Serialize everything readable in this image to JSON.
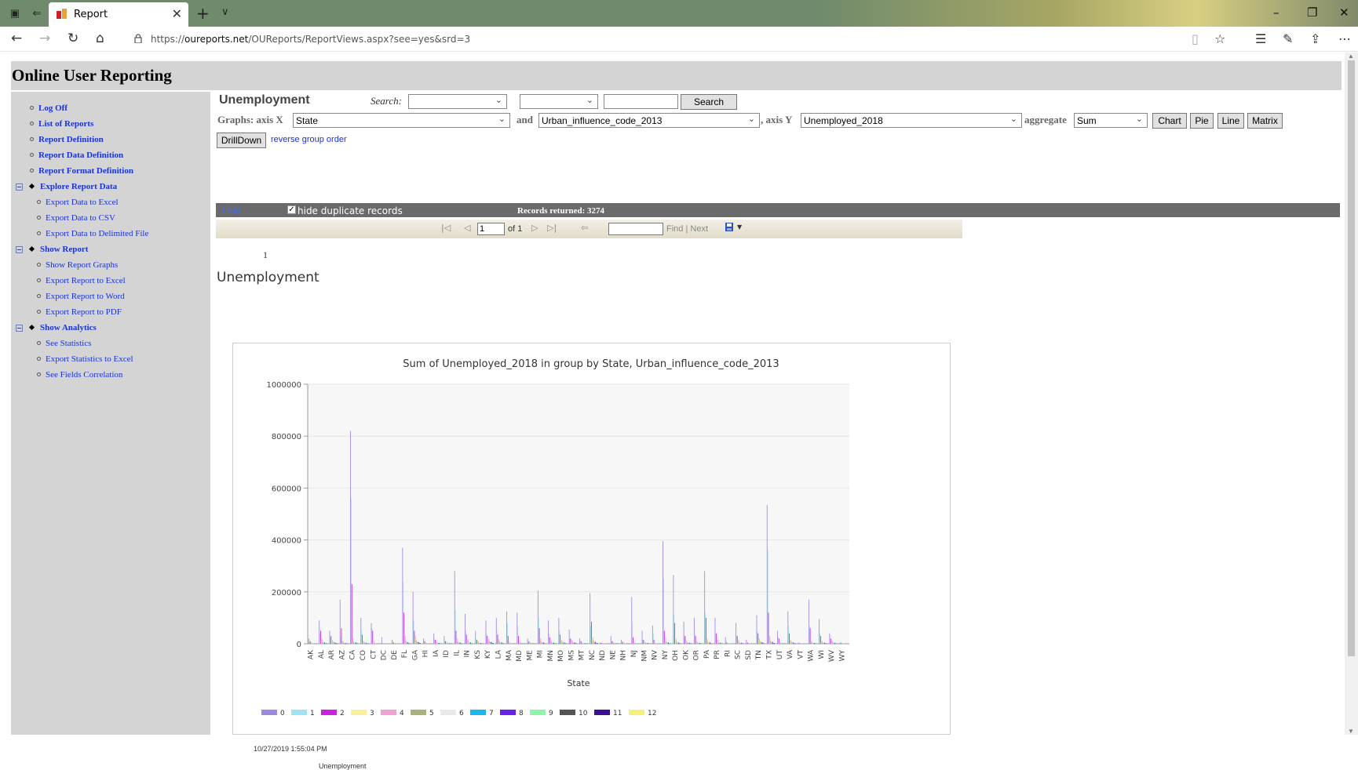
{
  "browser": {
    "tab_title": "Report",
    "url_prefix": "https://",
    "url_domain": "oureports.net",
    "url_path": "/OUReports/ReportViews.aspx?see=yes&srd=3"
  },
  "app": {
    "title": "Online User Reporting"
  },
  "sidebar": {
    "items": [
      {
        "label": "Log Off"
      },
      {
        "label": "List of Reports"
      },
      {
        "label": "Report Definition"
      },
      {
        "label": "Report Data Definition"
      },
      {
        "label": "Report Format Definition"
      }
    ],
    "groups": [
      {
        "label": "Explore Report Data",
        "toggle": "−",
        "children": [
          "Export Data to Excel",
          "Export Data to CSV",
          "Export Data to Delimited File"
        ]
      },
      {
        "label": "Show Report",
        "toggle": "−",
        "children": [
          "Show Report Graphs",
          "Export Report to Excel",
          "Export Report to Word",
          "Export Report to PDF"
        ]
      },
      {
        "label": "Show Analytics",
        "toggle": "−",
        "children": [
          "See Statistics",
          "Export Statistics to Excel",
          "See Fields Correlation"
        ]
      }
    ]
  },
  "report": {
    "title": "Unemployment",
    "search_label": "Search:",
    "search_button": "Search",
    "graphs_label": "Graphs: axis X",
    "axis_x": "State",
    "and_label": "and",
    "group_field": "Urban_influence_code_2013",
    "axis_y_label": ", axis Y",
    "axis_y": "Unemployed_2018",
    "aggregate_label": "aggregate",
    "aggregate": "Sum",
    "buttons": {
      "chart": "Chart",
      "pie": "Pie",
      "line": "Line",
      "matrix": "Matrix",
      "drilldown": "DrillDown"
    },
    "reverse_link": "reverse group order",
    "help": "Help",
    "hide_dup": "hide duplicate records",
    "records": "Records returned: 3274",
    "pager": {
      "page": "1",
      "of": "of 1",
      "find": "Find",
      "sep": "|",
      "next": "Next"
    },
    "page_number": "1",
    "heading": "Unemployment",
    "footer_date": "10/27/2019 1:55:04 PM",
    "footer_name": "Unemployment"
  },
  "chart_data": {
    "type": "bar",
    "title": "Sum of Unemployed_2018 in group by State, Urban_influence_code_2013",
    "xlabel": "State",
    "ylabel": "",
    "ylim": [
      0,
      1000000
    ],
    "yticks": [
      "0",
      "200000",
      "400000",
      "600000",
      "800000",
      "1000000"
    ],
    "categories": [
      "AK",
      "AL",
      "AR",
      "AZ",
      "CA",
      "CO",
      "CT",
      "DC",
      "DE",
      "FL",
      "GA",
      "HI",
      "IA",
      "ID",
      "IL",
      "IN",
      "KS",
      "KY",
      "LA",
      "MA",
      "MD",
      "ME",
      "MI",
      "MN",
      "MO",
      "MS",
      "MT",
      "NC",
      "ND",
      "NE",
      "NH",
      "NJ",
      "NM",
      "NV",
      "NY",
      "OH",
      "OK",
      "OR",
      "PA",
      "PR",
      "RI",
      "SC",
      "SD",
      "TN",
      "TX",
      "UT",
      "VA",
      "VT",
      "WA",
      "WI",
      "WV",
      "WY"
    ],
    "legend_position": "bottom",
    "series": [
      {
        "name": "0",
        "color": "#9b8ae0",
        "values": [
          20000,
          90000,
          50000,
          170000,
          820000,
          100000,
          80000,
          25000,
          15000,
          370000,
          200000,
          20000,
          40000,
          30000,
          280000,
          115000,
          50000,
          90000,
          100000,
          125000,
          120000,
          20000,
          205000,
          90000,
          100000,
          55000,
          20000,
          195000,
          5000,
          30000,
          15000,
          180000,
          50000,
          70000,
          395000,
          265000,
          85000,
          100000,
          280000,
          100000,
          25000,
          80000,
          15000,
          110000,
          535000,
          50000,
          125000,
          5000,
          170000,
          95000,
          40000,
          5000
        ]
      },
      {
        "name": "1",
        "color": "#9ee3f5",
        "values": [
          5000,
          40000,
          25000,
          25000,
          560000,
          50000,
          60000,
          0,
          8000,
          240000,
          90000,
          8000,
          20000,
          10000,
          130000,
          50000,
          20000,
          40000,
          50000,
          80000,
          70000,
          5000,
          100000,
          40000,
          50000,
          20000,
          8000,
          70000,
          2000,
          10000,
          5000,
          80000,
          15000,
          40000,
          250000,
          110000,
          30000,
          40000,
          120000,
          40000,
          10000,
          30000,
          5000,
          45000,
          360000,
          25000,
          70000,
          2000,
          70000,
          40000,
          20000,
          2000
        ]
      },
      {
        "name": "2",
        "color": "#cc22dd",
        "values": [
          10000,
          50000,
          30000,
          60000,
          230000,
          35000,
          50000,
          0,
          5000,
          120000,
          50000,
          10000,
          15000,
          10000,
          50000,
          35000,
          15000,
          30000,
          35000,
          30000,
          30000,
          10000,
          60000,
          25000,
          35000,
          20000,
          10000,
          85000,
          3000,
          10000,
          8000,
          25000,
          15000,
          15000,
          50000,
          80000,
          30000,
          30000,
          100000,
          40000,
          5000,
          30000,
          5000,
          40000,
          120000,
          20000,
          40000,
          3000,
          60000,
          30000,
          20000,
          4000
        ]
      },
      {
        "name": "3",
        "color": "#f7ef9a",
        "values": [
          3000,
          15000,
          12000,
          10000,
          15000,
          10000,
          5000,
          0,
          2000,
          20000,
          20000,
          3000,
          8000,
          6000,
          15000,
          12000,
          8000,
          15000,
          12000,
          5000,
          6000,
          5000,
          15000,
          10000,
          12000,
          10000,
          4000,
          20000,
          2000,
          5000,
          3000,
          5000,
          6000,
          3000,
          15000,
          15000,
          10000,
          8000,
          15000,
          10000,
          2000,
          10000,
          3000,
          15000,
          20000,
          5000,
          10000,
          2000,
          8000,
          10000,
          8000,
          2000
        ]
      },
      {
        "name": "4",
        "color": "#f2a0d0",
        "values": [
          6000,
          20000,
          15000,
          12000,
          20000,
          12000,
          10000,
          0,
          3000,
          30000,
          30000,
          5000,
          10000,
          7000,
          20000,
          18000,
          10000,
          20000,
          18000,
          8000,
          10000,
          6000,
          20000,
          12000,
          15000,
          15000,
          5000,
          25000,
          2000,
          6000,
          4000,
          8000,
          8000,
          4000,
          25000,
          20000,
          12000,
          10000,
          20000,
          15000,
          3000,
          15000,
          3000,
          20000,
          30000,
          6000,
          15000,
          2000,
          10000,
          12000,
          10000,
          2000
        ]
      },
      {
        "name": "5",
        "color": "#a9b27a",
        "values": [
          2000,
          8000,
          8000,
          5000,
          8000,
          6000,
          3000,
          0,
          1000,
          10000,
          12000,
          2000,
          5000,
          4000,
          8000,
          8000,
          5000,
          10000,
          8000,
          3000,
          4000,
          3000,
          8000,
          6000,
          8000,
          8000,
          3000,
          12000,
          1000,
          3000,
          2000,
          3000,
          4000,
          2000,
          8000,
          8000,
          6000,
          5000,
          8000,
          6000,
          1000,
          6000,
          2000,
          10000,
          12000,
          3000,
          8000,
          1000,
          5000,
          6000,
          6000,
          1000
        ]
      },
      {
        "name": "6",
        "color": "#e8e8e8",
        "values": [
          2000,
          6000,
          5000,
          4000,
          6000,
          5000,
          2000,
          0,
          1000,
          8000,
          8000,
          2000,
          4000,
          3000,
          6000,
          6000,
          4000,
          8000,
          6000,
          2000,
          3000,
          3000,
          6000,
          5000,
          6000,
          6000,
          3000,
          8000,
          1000,
          3000,
          2000,
          2000,
          3000,
          2000,
          6000,
          6000,
          5000,
          4000,
          6000,
          5000,
          1000,
          5000,
          2000,
          8000,
          10000,
          3000,
          6000,
          1000,
          4000,
          5000,
          5000,
          1000
        ]
      },
      {
        "name": "7",
        "color": "#1bb8f0",
        "values": [
          1000,
          4000,
          4000,
          3000,
          4000,
          3000,
          1000,
          0,
          500,
          5000,
          6000,
          1000,
          3000,
          2000,
          4000,
          4000,
          3000,
          6000,
          4000,
          1000,
          2000,
          2000,
          4000,
          3000,
          4000,
          4000,
          2000,
          6000,
          500,
          2000,
          1000,
          1000,
          2000,
          1000,
          4000,
          4000,
          3000,
          3000,
          4000,
          3000,
          500,
          3000,
          1000,
          5000,
          6000,
          2000,
          4000,
          500,
          3000,
          3000,
          3000,
          500
        ]
      },
      {
        "name": "8",
        "color": "#6a22f0",
        "values": [
          1500,
          5000,
          5000,
          3000,
          5000,
          4000,
          1000,
          0,
          500,
          6000,
          7000,
          1000,
          3000,
          2500,
          5000,
          5000,
          3000,
          7000,
          5000,
          1000,
          2000,
          2000,
          5000,
          4000,
          5000,
          5000,
          2000,
          7000,
          500,
          2000,
          1000,
          1000,
          2500,
          1000,
          5000,
          5000,
          4000,
          3000,
          5000,
          4000,
          500,
          4000,
          1500,
          6000,
          7000,
          2000,
          5000,
          500,
          3000,
          4000,
          4000,
          500
        ]
      },
      {
        "name": "9",
        "color": "#8ff5a8",
        "values": [
          1000,
          4000,
          4000,
          2000,
          3000,
          3000,
          1000,
          0,
          500,
          4000,
          5000,
          1000,
          2000,
          2000,
          3000,
          3000,
          2000,
          5000,
          3000,
          1000,
          1500,
          2000,
          3000,
          3000,
          3000,
          4000,
          2000,
          5000,
          500,
          2000,
          1000,
          500,
          2000,
          1000,
          3000,
          3000,
          3000,
          2000,
          3000,
          3000,
          500,
          3000,
          1000,
          4000,
          5000,
          1500,
          3000,
          500,
          2000,
          3000,
          3000,
          500
        ]
      },
      {
        "name": "10",
        "color": "#555555",
        "values": [
          500,
          2000,
          2000,
          1000,
          2000,
          1500,
          500,
          0,
          200,
          2000,
          3000,
          500,
          1000,
          1000,
          1500,
          1500,
          1000,
          3000,
          2000,
          500,
          1000,
          1000,
          1500,
          1500,
          2000,
          2000,
          1000,
          3000,
          200,
          1000,
          500,
          300,
          1000,
          500,
          1500,
          1500,
          1500,
          1000,
          1500,
          1500,
          200,
          1500,
          500,
          2000,
          3000,
          1000,
          2000,
          200,
          1000,
          1500,
          1500,
          200
        ]
      },
      {
        "name": "11",
        "color": "#3a118f",
        "values": [
          500,
          1500,
          1500,
          1000,
          1500,
          1000,
          300,
          0,
          200,
          1500,
          2000,
          500,
          1000,
          800,
          1000,
          1000,
          800,
          2000,
          1500,
          300,
          800,
          800,
          1000,
          1000,
          1500,
          1500,
          800,
          2000,
          200,
          800,
          300,
          200,
          800,
          300,
          1000,
          1000,
          1000,
          800,
          1000,
          1000,
          200,
          1000,
          500,
          1500,
          2000,
          800,
          1500,
          200,
          800,
          1000,
          1000,
          200
        ]
      },
      {
        "name": "12",
        "color": "#f5f07a",
        "values": [
          300,
          1000,
          1000,
          600,
          1000,
          800,
          200,
          0,
          100,
          1000,
          1500,
          300,
          800,
          600,
          800,
          800,
          600,
          1500,
          1000,
          200,
          600,
          600,
          800,
          800,
          1000,
          1000,
          600,
          1500,
          100,
          600,
          200,
          100,
          600,
          200,
          800,
          800,
          800,
          600,
          800,
          800,
          100,
          800,
          300,
          1000,
          1500,
          600,
          1000,
          100,
          600,
          800,
          800,
          100
        ]
      }
    ]
  }
}
